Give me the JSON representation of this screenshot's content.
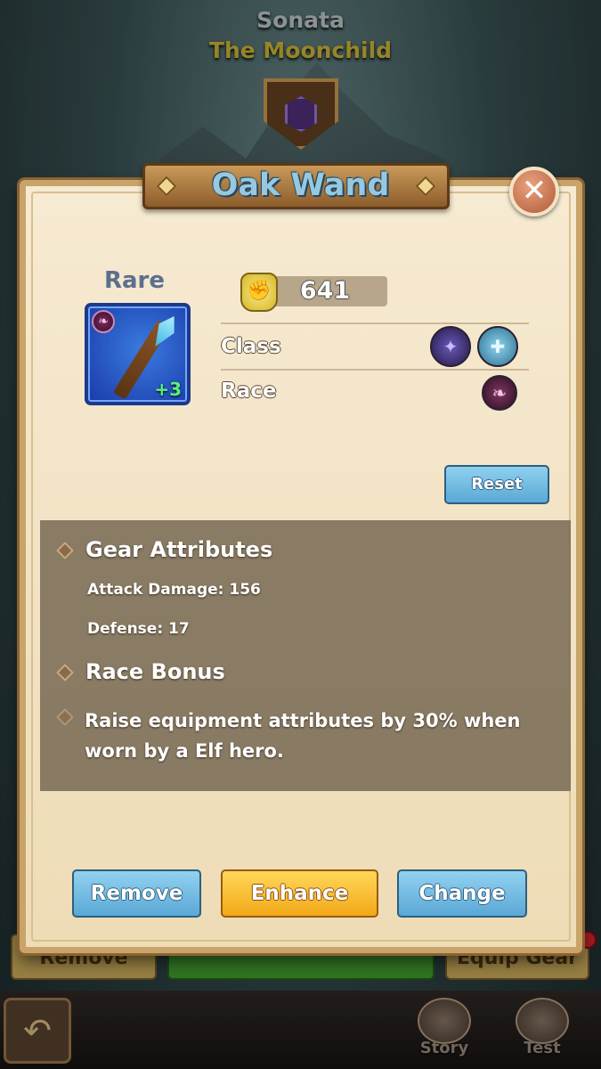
{
  "hero": {
    "name": "Sonata",
    "title": "The Moonchild"
  },
  "background_buttons": {
    "remove_gear": "Remove Gear",
    "equip_gear": "Equip Gear"
  },
  "nav": {
    "story": "Story",
    "test": "Test"
  },
  "modal": {
    "title": "Oak Wand",
    "item": {
      "rarity": "Rare",
      "enhance_level": "+3",
      "race_badge_icon": "elf-wing-icon",
      "power": "641",
      "power_icon": "fist-icon"
    },
    "labels": {
      "class": "Class",
      "race": "Race"
    },
    "class_icons": [
      "mage-icon",
      "support-icon"
    ],
    "race_icons": [
      "elf-icon"
    ],
    "reset_label": "Reset",
    "gear_attributes": {
      "heading": "Gear Attributes",
      "lines": [
        "Attack Damage: 156",
        "Defense: 17"
      ]
    },
    "race_bonus": {
      "heading": "Race Bonus",
      "text": "Raise equipment attributes by 30% when worn by a Elf hero."
    },
    "buttons": {
      "remove": "Remove",
      "enhance": "Enhance",
      "change": "Change"
    }
  },
  "colors": {
    "parchment": "#f3e5c8",
    "title_text": "#96c9df",
    "button_blue": "#6fb8e2",
    "button_gold": "#f8c230",
    "rarity_text": "#5c6f8e",
    "enhance_green": "#5af07a"
  }
}
